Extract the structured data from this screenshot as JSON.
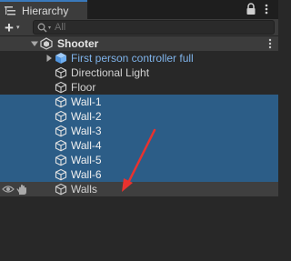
{
  "window": {
    "tab_label": "Hierarchy",
    "tab_icon": "hierarchy-list-icon",
    "lock_icon": "lock-icon",
    "menu_icon": "kebab-menu-icon"
  },
  "toolbar": {
    "add_icon": "plus-icon",
    "add_caret": "▾",
    "search_placeholder": "All",
    "search_icon": "search-icon"
  },
  "tree": {
    "scene": {
      "label": "Shooter",
      "icon": "unity-scene-icon",
      "expanded": true
    },
    "items": [
      {
        "label": "First person controller full",
        "icon": "prefab-cube-icon",
        "prefab": true,
        "collapsed": true,
        "selected": false
      },
      {
        "label": "Directional Light",
        "icon": "gameobject-cube-icon",
        "selected": false
      },
      {
        "label": "Floor",
        "icon": "gameobject-cube-icon",
        "selected": false
      },
      {
        "label": "Wall-1",
        "icon": "gameobject-cube-icon",
        "selected": true
      },
      {
        "label": "Wall-2",
        "icon": "gameobject-cube-icon",
        "selected": true
      },
      {
        "label": "Wall-3",
        "icon": "gameobject-cube-icon",
        "selected": true
      },
      {
        "label": "Wall-4",
        "icon": "gameobject-cube-icon",
        "selected": true
      },
      {
        "label": "Wall-5",
        "icon": "gameobject-cube-icon",
        "selected": true
      },
      {
        "label": "Wall-6",
        "icon": "gameobject-cube-icon",
        "selected": true
      },
      {
        "label": "Walls",
        "icon": "gameobject-cube-icon",
        "selected": false,
        "hovered": true
      }
    ]
  },
  "colors": {
    "selection": "#2c5d87",
    "prefab_text": "#7fb3ea",
    "annotation_arrow": "#e8322f"
  }
}
